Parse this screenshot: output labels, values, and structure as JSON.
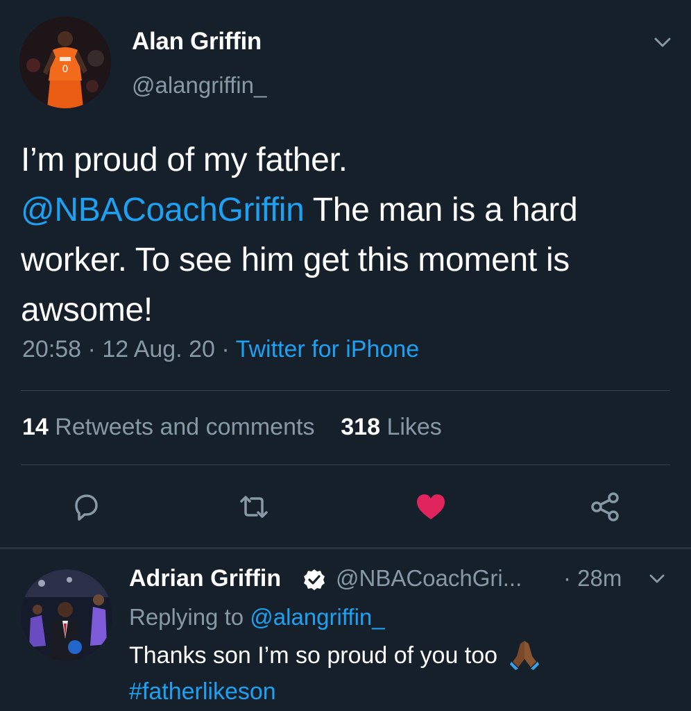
{
  "tweet": {
    "author": {
      "display_name": "Alan Griffin",
      "handle": "@alangriffin_",
      "avatar": "avatar-photo"
    },
    "text": {
      "line1": "I’m proud of my father.",
      "mention": "@NBACoachGriffin",
      "after_mention": " The man is a hard worker. To see him get this moment is awsome!"
    },
    "time": "20:58",
    "separator": "·",
    "date": "12 Aug. 20",
    "source": "Twitter for iPhone",
    "stats": {
      "retweets_count": "14",
      "retweets_label": "Retweets and comments",
      "likes_count": "318",
      "likes_label": "Likes"
    },
    "actions": [
      {
        "name": "reply",
        "icon": "comment-icon"
      },
      {
        "name": "retweet",
        "icon": "retweet-icon"
      },
      {
        "name": "like",
        "icon": "heart-icon",
        "active": true,
        "color": "#e0245e"
      },
      {
        "name": "share",
        "icon": "share-icon"
      }
    ],
    "menu_icon": "chevron-down-icon"
  },
  "reply": {
    "author": {
      "display_name": "Adrian Griffin",
      "verified": true,
      "handle": "@NBACoachGri...",
      "avatar": "avatar-photo"
    },
    "time": "· 28m",
    "replying_prefix": "Replying to ",
    "replying_to": "@alangriffin_",
    "text": "Thanks son I’m so proud of you too",
    "emoji": "folded-hands-emoji",
    "hashtag": "#fatherlikeson"
  },
  "colors": {
    "background": "#15202b",
    "primary_text": "#ffffff",
    "secondary_text": "#8899a6",
    "link": "#1da1f2",
    "like": "#e0245e",
    "divider": "#38444d"
  }
}
